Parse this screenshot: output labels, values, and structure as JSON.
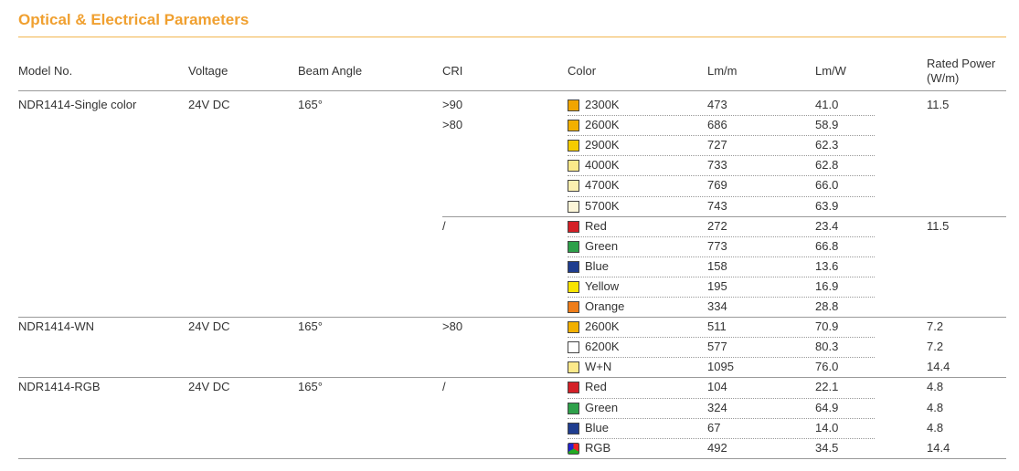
{
  "title": "Optical & Electrical Parameters",
  "headers": {
    "model": "Model No.",
    "voltage": "Voltage",
    "beam": "Beam Angle",
    "cri": "CRI",
    "color": "Color",
    "lmm": "Lm/m",
    "lmw": "Lm/W",
    "power_line1": "Rated Power",
    "power_line2": "(W/m)"
  },
  "groups": [
    {
      "model": "NDR1414-Single color",
      "voltage": "24V DC",
      "beam": "165°",
      "rows": [
        {
          "cri": ">90",
          "color": "2300K",
          "swatch": "#f0a500",
          "lmm": "473",
          "lmw": "41.0",
          "power": "11.5"
        },
        {
          "cri": ">80",
          "color": "2600K",
          "swatch": "#f2b000",
          "lmm": "686",
          "lmw": "58.9",
          "power": ""
        },
        {
          "cri": "",
          "color": "2900K",
          "swatch": "#f5cc00",
          "lmm": "727",
          "lmw": "62.3",
          "power": ""
        },
        {
          "cri": "",
          "color": "4000K",
          "swatch": "#fbe98a",
          "lmm": "733",
          "lmw": "62.8",
          "power": ""
        },
        {
          "cri": "",
          "color": "4700K",
          "swatch": "#fcf0b0",
          "lmm": "769",
          "lmw": "66.0",
          "power": ""
        },
        {
          "cri": "",
          "color": "5700K",
          "swatch": "#fdf6d8",
          "lmm": "743",
          "lmw": "63.9",
          "power": ""
        },
        {
          "cri": "/",
          "color": "Red",
          "swatch": "#d42027",
          "lmm": "272",
          "lmw": "23.4",
          "power": "11.5"
        },
        {
          "cri": "",
          "color": "Green",
          "swatch": "#2ea04a",
          "lmm": "773",
          "lmw": "66.8",
          "power": ""
        },
        {
          "cri": "",
          "color": "Blue",
          "swatch": "#1f3d8f",
          "lmm": "158",
          "lmw": "13.6",
          "power": ""
        },
        {
          "cri": "",
          "color": "Yellow",
          "swatch": "#f7e400",
          "lmm": "195",
          "lmw": "16.9",
          "power": ""
        },
        {
          "cri": "",
          "color": "Orange",
          "swatch": "#ee7d1a",
          "lmm": "334",
          "lmw": "28.8",
          "power": ""
        }
      ]
    },
    {
      "model": "NDR1414-WN",
      "voltage": "24V DC",
      "beam": "165°",
      "rows": [
        {
          "cri": ">80",
          "color": "2600K",
          "swatch": "#f2b000",
          "lmm": "511",
          "lmw": "70.9",
          "power": "7.2"
        },
        {
          "cri": "",
          "color": "6200K",
          "swatch": "#ffffff",
          "lmm": "577",
          "lmw": "80.3",
          "power": "7.2"
        },
        {
          "cri": "",
          "color": "W+N",
          "swatch": "#fbe98a",
          "lmm": "1095",
          "lmw": "76.0",
          "power": "14.4"
        }
      ]
    },
    {
      "model": "NDR1414-RGB",
      "voltage": "24V DC",
      "beam": "165°",
      "rows": [
        {
          "cri": "/",
          "color": "Red",
          "swatch": "#d42027",
          "lmm": "104",
          "lmw": "22.1",
          "power": "4.8"
        },
        {
          "cri": "",
          "color": "Green",
          "swatch": "#2ea04a",
          "lmm": "324",
          "lmw": "64.9",
          "power": "4.8"
        },
        {
          "cri": "",
          "color": "Blue",
          "swatch": "#1f3d8f",
          "lmm": "67",
          "lmw": "14.0",
          "power": "4.8"
        },
        {
          "cri": "",
          "color": "RGB",
          "swatch": "rgb-icon",
          "lmm": "492",
          "lmw": "34.5",
          "power": "14.4"
        }
      ]
    }
  ]
}
